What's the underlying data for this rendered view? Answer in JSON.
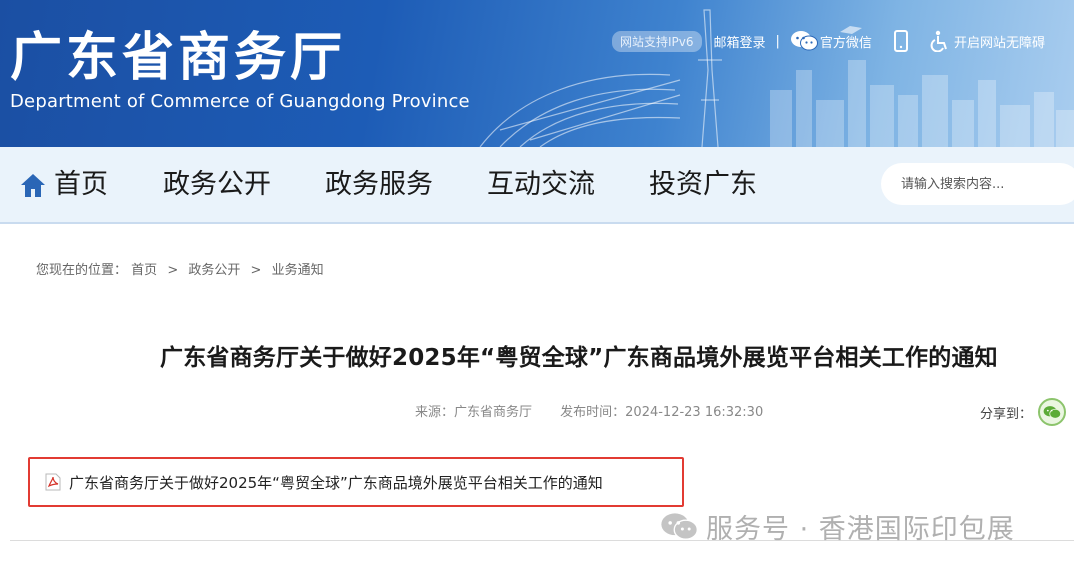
{
  "header": {
    "title": "广东省商务厅",
    "subtitle": "Department of Commerce of Guangdong Province",
    "ipv6_badge": "网站支持IPv6",
    "mail_login": "邮箱登录",
    "separator": "|",
    "wechat": "官方微信",
    "accessibility": "开启网站无障碍"
  },
  "nav": {
    "items": [
      "首页",
      "政务公开",
      "政务服务",
      "互动交流",
      "投资广东"
    ],
    "search_placeholder": "请输入搜索内容..."
  },
  "breadcrumb": {
    "label": "您现在的位置：",
    "items": [
      "首页",
      "政务公开",
      "业务通知"
    ],
    "separator": ">"
  },
  "article": {
    "title": "广东省商务厅关于做好2025年“粤贸全球”广东商品境外展览平台相关工作的通知",
    "source": "来源：广东省商务厅",
    "publish_time": "发布时间：2024-12-23 16:32:30",
    "share_label": "分享到：",
    "attachment": "广东省商务厅关于做好2025年“粤贸全球”广东商品境外展览平台相关工作的通知"
  },
  "watermark": "服务号 · 香港国际印包展",
  "colors": {
    "banner_blue": "#1d5cb6",
    "nav_bg": "#eaf3fb",
    "highlight_red": "#e23b33",
    "share_green": "#8cc46c"
  },
  "icons": [
    "phone-icon",
    "wechat-icon",
    "accessibility-icon",
    "home-icon",
    "pdf-icon",
    "share-wechat-icon"
  ]
}
